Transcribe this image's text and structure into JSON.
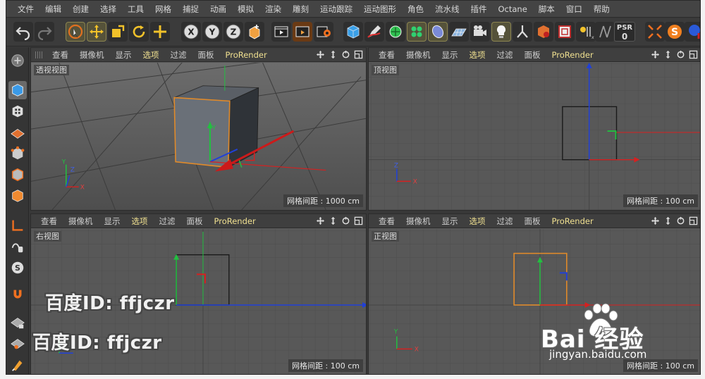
{
  "menubar": {
    "items": [
      "文件",
      "编辑",
      "创建",
      "选择",
      "工具",
      "网格",
      "捕捉",
      "动画",
      "模拟",
      "渲染",
      "雕刻",
      "运动跟踪",
      "运动图形",
      "角色",
      "流水线",
      "插件",
      "Octane",
      "脚本",
      "窗口",
      "帮助"
    ]
  },
  "toolbar": {
    "psr_label": "PSR",
    "psr_value": "0",
    "axis_x": "X",
    "axis_y": "Y",
    "axis_z": "Z"
  },
  "viewport_menu": [
    "查看",
    "摄像机",
    "显示",
    "选项",
    "过滤",
    "面板",
    "ProRender"
  ],
  "viewports": {
    "perspective": {
      "title": "透视视图",
      "status": "网格间距 : 1000 cm"
    },
    "top": {
      "title": "顶视图",
      "status": "网格间距 : 100 cm"
    },
    "right": {
      "title": "右视图",
      "status": "网格间距 : 100 cm"
    },
    "front": {
      "title": "正视图",
      "status": "网格间距 : 100 cm"
    }
  },
  "watermark": {
    "text": "百度ID: ffjczr",
    "logo_word": "Bai  经验",
    "logo_sub": "jingyan.baidu.com"
  },
  "colors": {
    "axis_x": "#d62020",
    "axis_y": "#22c040",
    "axis_z": "#2040d8",
    "selection": "#e08a2a",
    "annotation_arrow": "#cc1a1a"
  },
  "axis_labels": {
    "x": "X",
    "y": "Y",
    "z": "Z"
  }
}
